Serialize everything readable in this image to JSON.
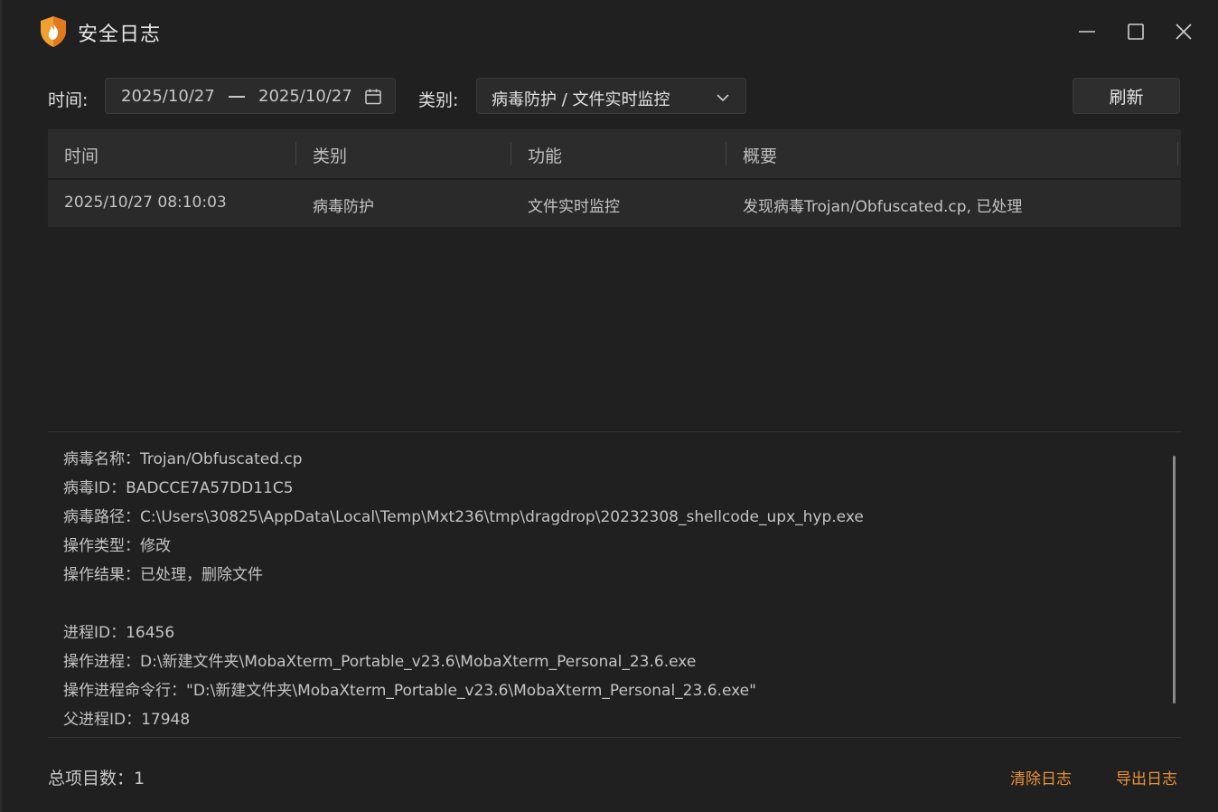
{
  "window": {
    "title": "安全日志",
    "accent": "#e8913a"
  },
  "filter": {
    "time_label": "时间:",
    "date_from": "2025/10/27",
    "date_to": "2025/10/27",
    "category_label": "类别:",
    "category_value": "病毒防护 / 文件实时监控",
    "refresh_label": "刷新"
  },
  "table": {
    "headers": [
      "时间",
      "类别",
      "功能",
      "概要"
    ],
    "rows": [
      [
        "2025/10/27 08:10:03",
        "病毒防护",
        "文件实时监控",
        "发现病毒Trojan/Obfuscated.cp, 已处理"
      ]
    ]
  },
  "details": {
    "lines": [
      "病毒名称：Trojan/Obfuscated.cp",
      "病毒ID：BADCCE7A57DD11C5",
      "病毒路径：C:\\Users\\30825\\AppData\\Local\\Temp\\Mxt236\\tmp\\dragdrop\\20232308_shellcode_upx_hyp.exe",
      "操作类型：修改",
      "操作结果：已处理，删除文件",
      "",
      "进程ID：16456",
      "操作进程：D:\\新建文件夹\\MobaXterm_Portable_v23.6\\MobaXterm_Personal_23.6.exe",
      "操作进程命令行：\"D:\\新建文件夹\\MobaXterm_Portable_v23.6\\MobaXterm_Personal_23.6.exe\"",
      "父进程ID：17948"
    ]
  },
  "footer": {
    "total_label": "总项目数：",
    "total_count": "1",
    "clear_label": "清除日志",
    "export_label": "导出日志"
  },
  "icons": [
    "shield-flame-icon",
    "calendar-icon",
    "chevron-down-icon",
    "minimize-icon",
    "maximize-icon",
    "close-icon"
  ]
}
